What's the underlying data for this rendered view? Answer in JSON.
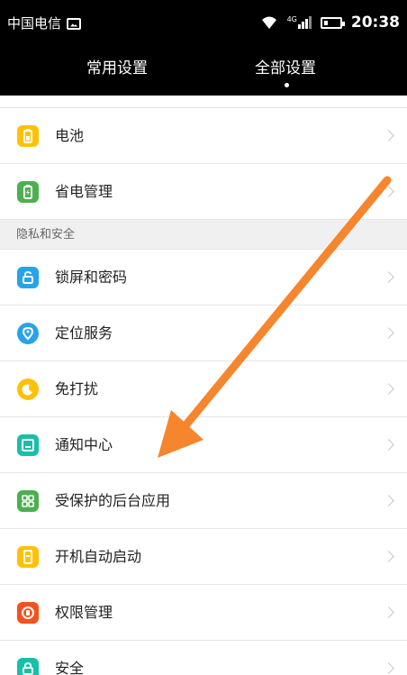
{
  "status_bar": {
    "carrier": "中国电信",
    "network_tag": "4G",
    "time": "20:38"
  },
  "tabs": {
    "common": "常用设置",
    "all": "全部设置",
    "selected": "all"
  },
  "list": {
    "battery": {
      "label": "电池",
      "icon": "battery-icon",
      "color": "#FFC107"
    },
    "power_saving": {
      "label": "省电管理",
      "icon": "power-saving-icon",
      "color": "#4CAF50"
    },
    "section_privacy": "隐私和安全",
    "lockscreen": {
      "label": "锁屏和密码",
      "icon": "lock-icon",
      "color": "#29A3E8"
    },
    "location": {
      "label": "定位服务",
      "icon": "location-pin-icon",
      "color": "#29A3E8"
    },
    "dnd": {
      "label": "免打扰",
      "icon": "moon-icon",
      "color": "#FFC107"
    },
    "notifications": {
      "label": "通知中心",
      "icon": "notification-icon",
      "color": "#19BFA8"
    },
    "protected_apps": {
      "label": "受保护的后台应用",
      "icon": "apps-icon",
      "color": "#4CAF50"
    },
    "autostart": {
      "label": "开机自动启动",
      "icon": "autostart-icon",
      "color": "#FFC107"
    },
    "permissions": {
      "label": "权限管理",
      "icon": "permissions-icon",
      "color": "#F4511E"
    },
    "security": {
      "label": "安全",
      "icon": "security-icon",
      "color": "#19BFA8"
    }
  },
  "annotation": {
    "arrow_color": "#F5862E"
  }
}
